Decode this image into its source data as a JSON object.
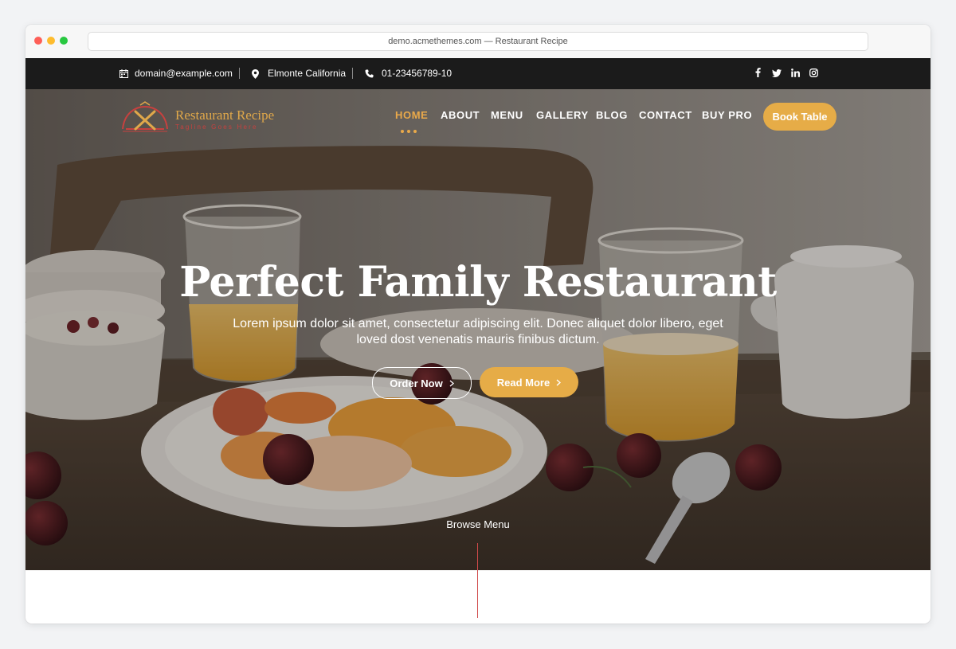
{
  "browser": {
    "url": "demo.acmethemes.com — Restaurant Recipe"
  },
  "topbar": {
    "email": "domain@example.com",
    "location": "Elmonte California",
    "phone": "01-23456789-10",
    "social_icons": [
      "facebook-icon",
      "twitter-icon",
      "linkedin-icon",
      "instagram-icon"
    ]
  },
  "logo": {
    "title": "Restaurant Recipe",
    "tagline": "Tagline Goes Here"
  },
  "nav": {
    "items": [
      {
        "label": "HOME",
        "active": true
      },
      {
        "label": "ABOUT"
      },
      {
        "label": "MENU"
      },
      {
        "label": "GALLERY"
      },
      {
        "label": "BLOG"
      },
      {
        "label": "CONTACT"
      },
      {
        "label": "BUY PRO"
      }
    ],
    "cta": "Book Table"
  },
  "hero": {
    "title": "Perfect Family Restaurant",
    "subtitle": "Lorem ipsum dolor sit amet, consectetur adipiscing elit. Donec aliquet dolor libero, eget loved dost venenatis mauris finibus dictum.",
    "primary_button": "Order Now",
    "secondary_button": "Read More",
    "browse_label": "Browse Menu"
  },
  "colors": {
    "accent": "#e6ac47",
    "logo_red": "#c7413f",
    "topbar_bg": "#1b1b1b"
  }
}
